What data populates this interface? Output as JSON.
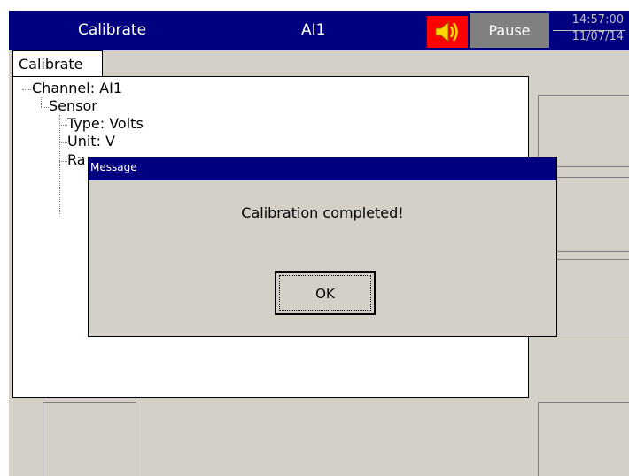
{
  "titlebar": {
    "title": "Calibrate",
    "channel": "AI1",
    "speaker_icon": "speaker-icon",
    "pause_label": "Pause",
    "time": "14:57:00",
    "date": "11/07/14"
  },
  "panel": {
    "tab_label": "Calibrate",
    "tree": {
      "channel": "Channel: AI1",
      "sensor": "Sensor",
      "type": "Type: Volts",
      "unit": "Unit: V",
      "range_partial": "Ra"
    }
  },
  "dialog": {
    "title": "Message",
    "message": "Calibration completed!",
    "ok_label": "OK"
  },
  "colors": {
    "titlebar": "#000080",
    "speaker_bg": "#ff0000",
    "pause_bg": "#808080",
    "panel_bg": "#d4d0c8"
  }
}
